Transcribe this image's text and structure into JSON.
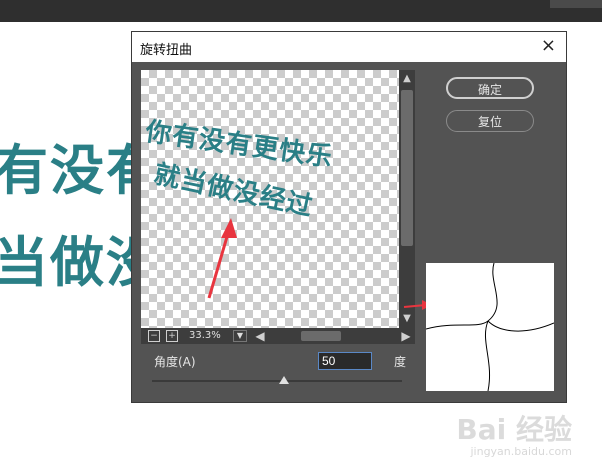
{
  "background": {
    "text_line1": "有没有",
    "text_line2": "当做没"
  },
  "dialog": {
    "title": "旋转扭曲",
    "close_glyph": "×",
    "preview": {
      "text_line1": "你有没有更快乐",
      "text_line2": "就当做没经过",
      "zoom": "33.3%"
    },
    "buttons": {
      "ok": "确定",
      "reset": "复位"
    },
    "angle": {
      "label": "角度(A)",
      "value": "50",
      "unit": "度",
      "slider_value": 50
    }
  },
  "watermark": {
    "text": "Bai 经验",
    "sub": "jingyan.baidu.com"
  },
  "colors": {
    "accent_text": "#2a7f86",
    "dialog_bg": "#535353",
    "arrow": "#e8353f"
  }
}
